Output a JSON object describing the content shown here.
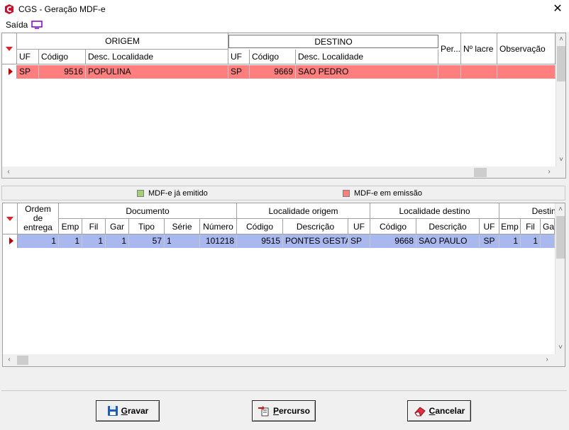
{
  "window": {
    "title": "CGS - Geração MDF-e",
    "close": "✕"
  },
  "menu": {
    "saida": "Saída"
  },
  "top_grid": {
    "group_headers": {
      "origem": "ORIGEM",
      "destino": "DESTINO"
    },
    "columns": {
      "uf": "UF",
      "codigo": "Código",
      "desc": "Desc. Localidade",
      "uf2": "UF",
      "codigo2": "Código",
      "desc2": "Desc. Localidade",
      "per": "Per...",
      "lacre": "Nº lacre",
      "obs": "Observação"
    },
    "rows": [
      {
        "uf": "SP",
        "codigo": "9516",
        "desc": "POPULINA",
        "uf2": "SP",
        "codigo2": "9669",
        "desc2": "SAO PEDRO",
        "per": "",
        "lacre": "",
        "obs": ""
      }
    ],
    "row_color": "#ff7f7f"
  },
  "legend": {
    "emitido": {
      "label": "MDF-e já emitido",
      "color": "#a0d070"
    },
    "emissao": {
      "label": "MDF-e em emissão",
      "color": "#ff7f7f"
    }
  },
  "bottom_grid": {
    "group_headers": {
      "ordem": "Ordem de entrega",
      "documento": "Documento",
      "loc_origem": "Localidade origem",
      "loc_destino": "Localidade destino",
      "destino": "Destino"
    },
    "columns": {
      "emp": "Emp",
      "fil": "Fil",
      "gar": "Gar",
      "tipo": "Tipo",
      "serie": "Série",
      "numero": "Número",
      "codigo": "Código",
      "descricao": "Descrição",
      "uf": "UF",
      "codigo2": "Código",
      "descricao2": "Descrição",
      "uf2": "UF",
      "emp2": "Emp",
      "fil2": "Fil",
      "gar2": "Ga"
    },
    "rows": [
      {
        "ordem": "1",
        "emp": "1",
        "fil": "1",
        "gar": "1",
        "tipo": "57",
        "serie": "1",
        "numero": "101218",
        "codigo": "9515",
        "descricao": "PONTES GESTAL",
        "uf": "SP",
        "codigo2": "9668",
        "descricao2": "SAO PAULO",
        "uf2": "SP",
        "emp2": "1",
        "fil2": "1",
        "gar2": ""
      }
    ],
    "row_color": "#a9b8ee"
  },
  "buttons": {
    "gravar": {
      "label": "Gravar",
      "accel": "G",
      "rest": "ravar"
    },
    "percurso": {
      "label": "Percurso",
      "accel": "P",
      "rest": "ercurso"
    },
    "cancelar": {
      "label": "Cancelar",
      "accel": "C",
      "rest": "ancelar"
    }
  }
}
